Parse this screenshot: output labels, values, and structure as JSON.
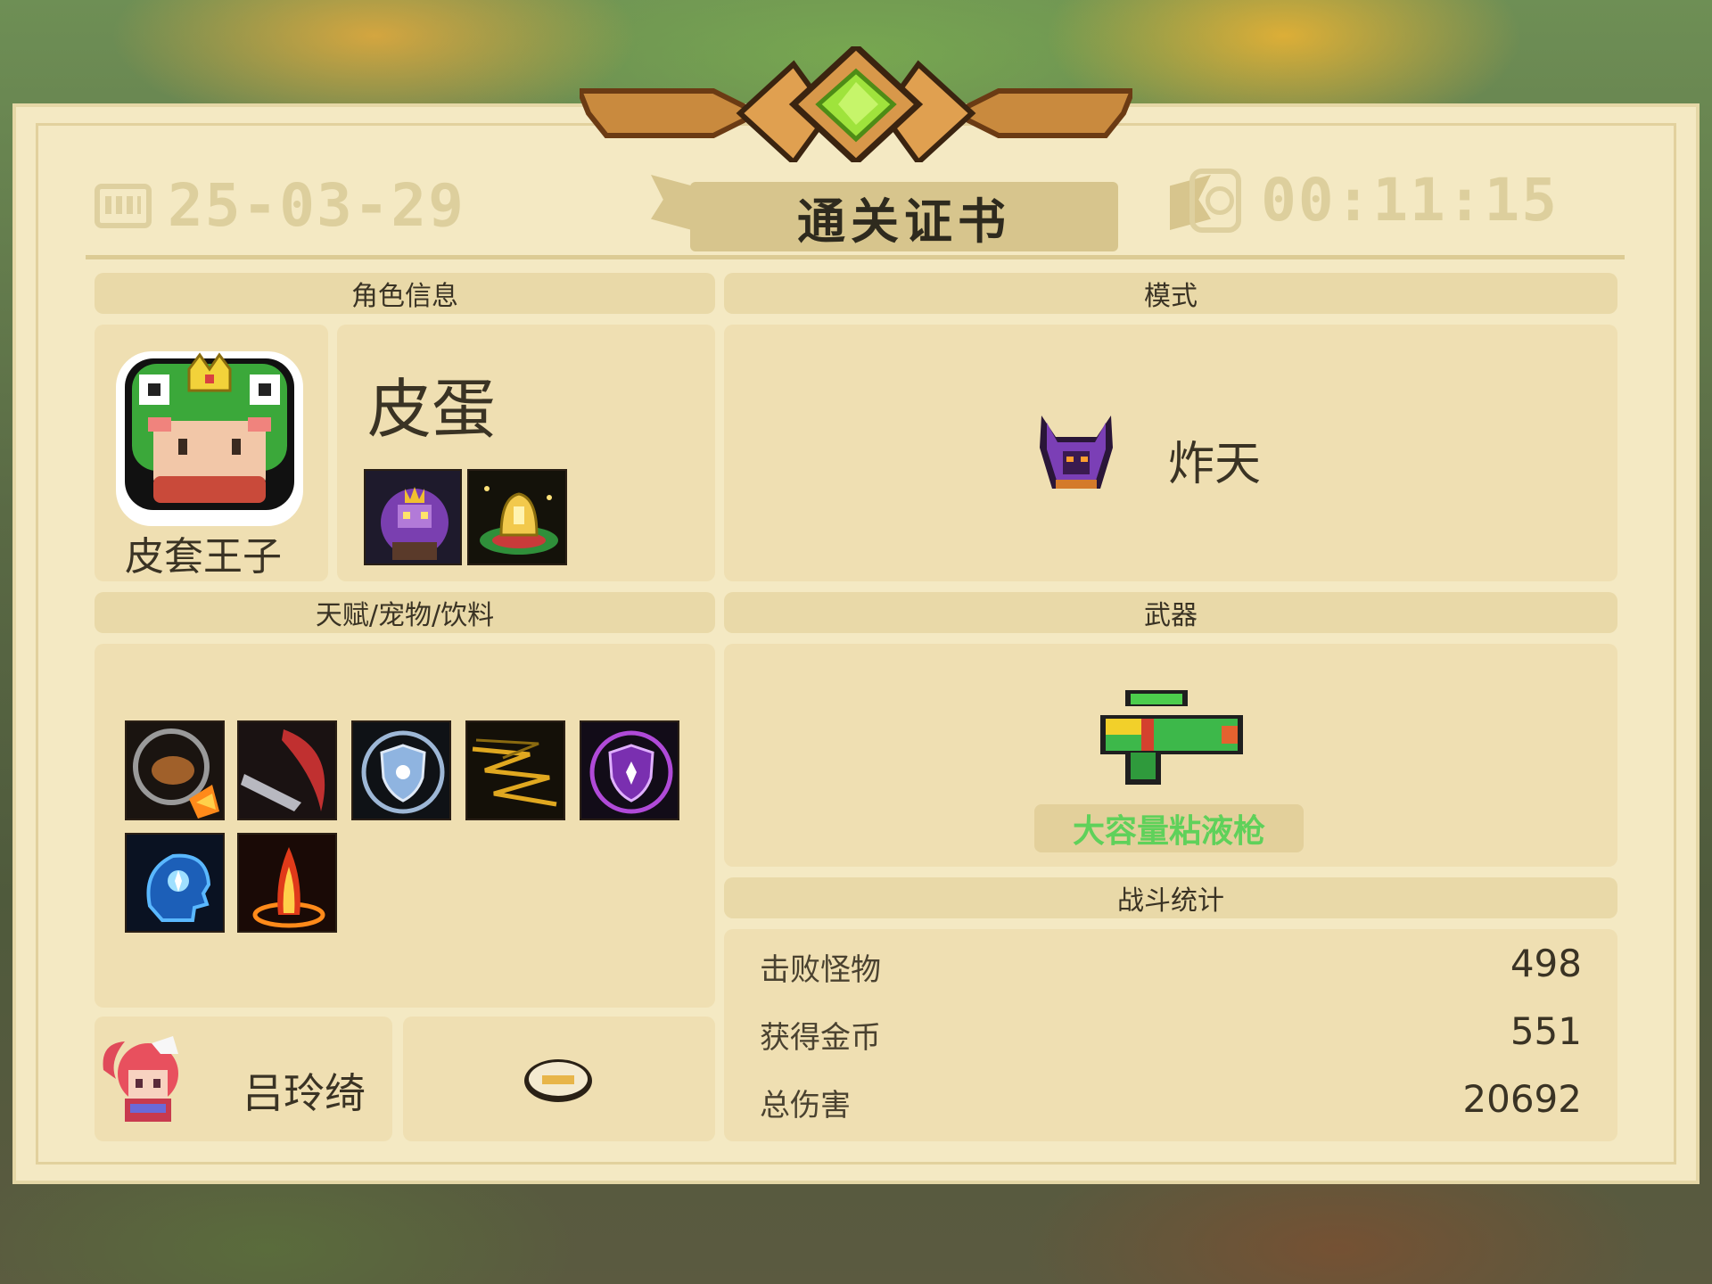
{
  "certificate": {
    "title": "通关证书",
    "date": "25-03-29",
    "time": "00:11:15"
  },
  "sections": {
    "character": "角色信息",
    "mode": "模式",
    "talents": "天赋/宠物/饮料",
    "weapon": "武器",
    "stats": "战斗统计"
  },
  "character": {
    "name": "皮蛋",
    "skin": "皮套王子",
    "portrait_icon": "frog-hood-prince-icon",
    "skill_icons": [
      "purple-demon-skill-icon",
      "golden-bell-skill-icon"
    ]
  },
  "mode": {
    "name": "炸天",
    "icon": "purple-horned-helmet-icon"
  },
  "talents": [
    "hamster-wheel-talent-icon",
    "curved-blade-talent-icon",
    "frost-shield-talent-icon",
    "lightning-zigzag-talent-icon",
    "purple-shield-talent-icon",
    "blue-mind-talent-icon",
    "fire-pillar-talent-icon"
  ],
  "pet": {
    "name": "吕玲绮",
    "icon": "red-haired-girl-pet-icon"
  },
  "drink": {
    "icon": "drink-dish-icon"
  },
  "weapon": {
    "name": "大容量粘液枪",
    "icon": "green-slime-gun-icon",
    "name_color": "#5fd15a"
  },
  "stats": [
    {
      "label": "击败怪物",
      "value": "498"
    },
    {
      "label": "获得金币",
      "value": "551"
    },
    {
      "label": "总伤害",
      "value": "20692"
    }
  ]
}
